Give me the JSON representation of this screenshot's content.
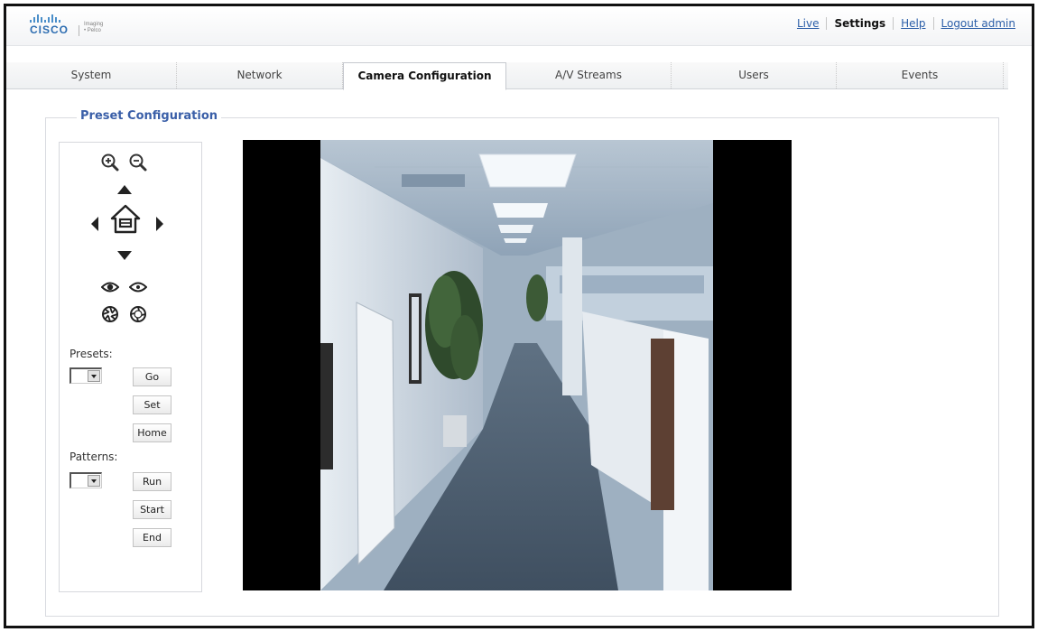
{
  "brand": {
    "company": "CISCO",
    "product_line_1": "Imaging",
    "product_line_2": "• Pelco"
  },
  "top_nav": {
    "live": "Live",
    "settings": "Settings",
    "help": "Help",
    "logout": "Logout admin"
  },
  "tabs": [
    {
      "label": "System"
    },
    {
      "label": "Network"
    },
    {
      "label": "Camera Configuration",
      "active": true
    },
    {
      "label": "A/V Streams"
    },
    {
      "label": "Users"
    },
    {
      "label": "Events"
    }
  ],
  "preset_panel": {
    "title": "Preset Configuration",
    "presets_label": "Presets:",
    "presets_selected": "",
    "go_label": "Go",
    "set_label": "Set",
    "home_label": "Home",
    "patterns_label": "Patterns:",
    "patterns_selected": "",
    "run_label": "Run",
    "start_label": "Start",
    "end_label": "End"
  },
  "icons": {
    "zoom_in": "zoom-in-icon",
    "zoom_out": "zoom-out-icon",
    "pan_up": "arrow-up-icon",
    "pan_left": "arrow-left-icon",
    "home": "home-icon",
    "pan_right": "arrow-right-icon",
    "pan_down": "arrow-down-icon",
    "focus_near": "focus-near-icon",
    "focus_far": "focus-far-icon",
    "iris_close": "iris-close-icon",
    "iris_open": "iris-open-icon"
  },
  "colors": {
    "link": "#2b5ea8",
    "legend": "#3a5fa8",
    "cisco_blue": "#2d6db1"
  }
}
